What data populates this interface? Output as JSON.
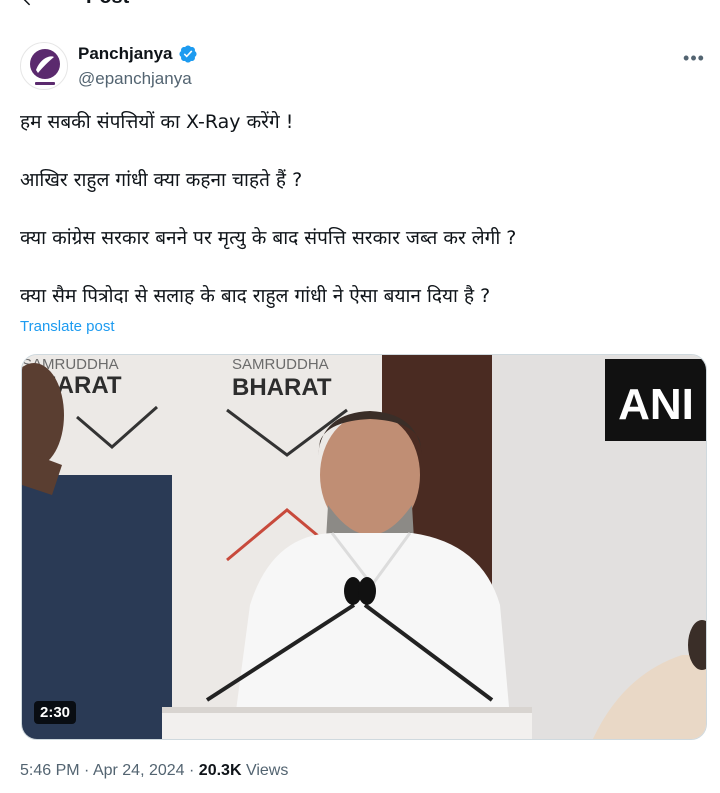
{
  "topbar": {
    "title": "Post"
  },
  "author": {
    "display_name": "Panchjanya",
    "handle": "@epanchjanya"
  },
  "tweet": {
    "lines": [
      "हम सबकी संपत्तियों का X-Ray करेंगे !",
      "आखिर राहुल गांधी क्या कहना चाहते हैं ?",
      "क्या कांग्रेस सरकार बनने पर मृत्यु के बाद संपत्ति सरकार जब्त कर लेगी ?",
      "क्या सैम पित्रोदा से सलाह के बाद राहुल गांधी ने ऐसा बयान दिया है ?"
    ],
    "translate_label": "Translate post"
  },
  "media": {
    "backdrop_text_1": "SAMRUDDHA",
    "backdrop_text_2": "BHARAT",
    "backdrop_text_3": "SAMRUDDHA",
    "backdrop_text_4": "BHARAT",
    "watermark": "ANI",
    "duration": "2:30"
  },
  "meta": {
    "time": "5:46 PM",
    "date": "Apr 24, 2024",
    "views_count": "20.3K",
    "views_label": "Views",
    "separator": "·"
  },
  "colors": {
    "link": "#1d9bf0",
    "secondary_text": "#536471",
    "verified": "#1d9bf0"
  }
}
